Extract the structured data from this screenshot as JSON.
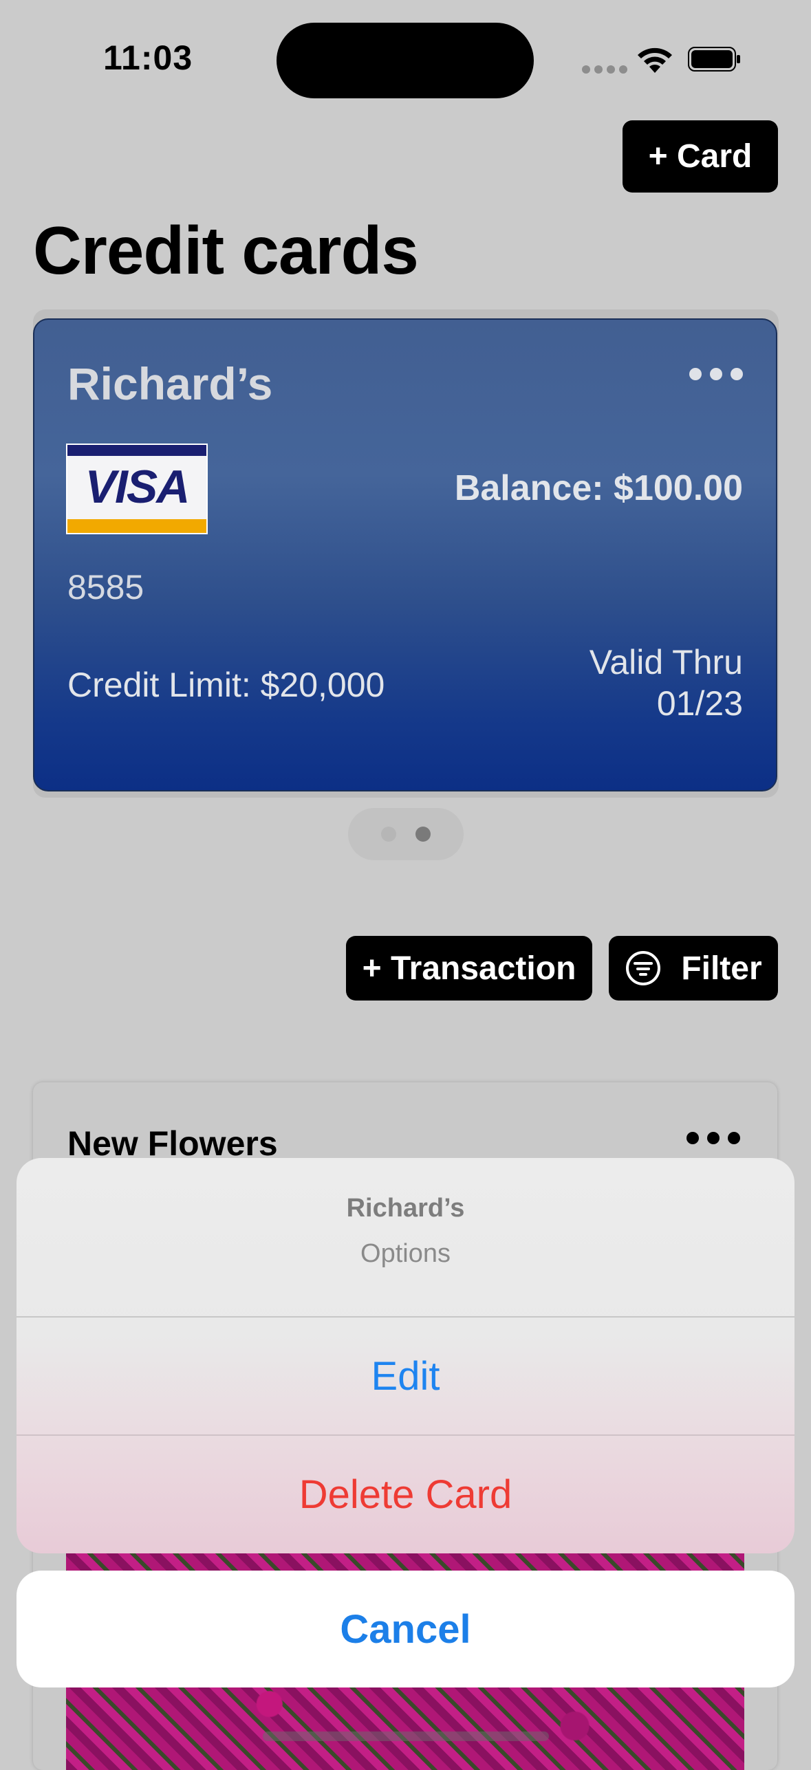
{
  "status_bar": {
    "time": "11:03"
  },
  "header": {
    "add_card_label": "+ Card",
    "title": "Credit cards"
  },
  "card": {
    "name": "Richard’s",
    "brand": "VISA",
    "balance": "Balance: $100.00",
    "number": "8585",
    "credit_limit": "Credit Limit: $20,000",
    "valid_label": "Valid Thru",
    "valid_date": "01/23"
  },
  "actions": {
    "add_transaction_label": "+ Transaction",
    "filter_label": "Filter"
  },
  "transaction": {
    "title": "New Flowers"
  },
  "action_sheet": {
    "title": "Richard’s",
    "subtitle": "Options",
    "edit_label": "Edit",
    "delete_label": "Delete Card",
    "cancel_label": "Cancel"
  },
  "colors": {
    "accent_blue": "#1e84f0",
    "destructive_red": "#ee3b34",
    "card_blue": "#2e4f8c"
  },
  "icons": [
    "wifi-icon",
    "battery-icon",
    "more-icon",
    "filter-icon"
  ]
}
